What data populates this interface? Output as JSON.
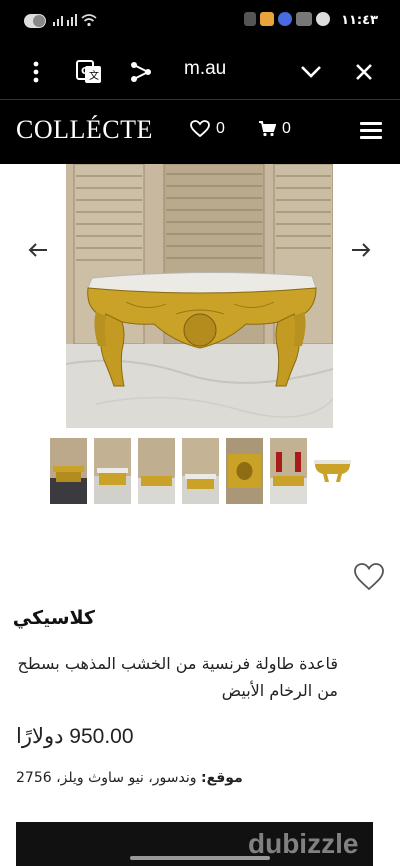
{
  "status_bar": {
    "time": "١١:٤٣",
    "icons": [
      "wifi-icon",
      "signal-icon",
      "sim-signal-icon",
      "battery-icon",
      "messenger-icon",
      "photo-app-icon"
    ]
  },
  "browser": {
    "url": "m.au",
    "icons": [
      "more-vert-icon",
      "translate-icon",
      "share-icon",
      "chevron-down-icon",
      "close-icon"
    ]
  },
  "site_header": {
    "logo": "COLLÉCTE",
    "wishlist_count": "0",
    "cart_count": "0"
  },
  "gallery": {
    "thumbnail_count": 7,
    "selected_index": 6
  },
  "product": {
    "brand": "كلاسيكي",
    "title": "قاعدة طاولة فرنسية من الخشب المذهب بسطح من الرخام الأبيض",
    "price": "950.00 دولارًا",
    "location_label": "موقع:",
    "location_value": "وندسور، نيو ساوث ويلز، 2756"
  },
  "watermark": "dubizzle",
  "colors": {
    "header_bg": "#000000",
    "gold": "#c9a227",
    "marble": "#e4e2dc",
    "wood": "#c2b193"
  }
}
